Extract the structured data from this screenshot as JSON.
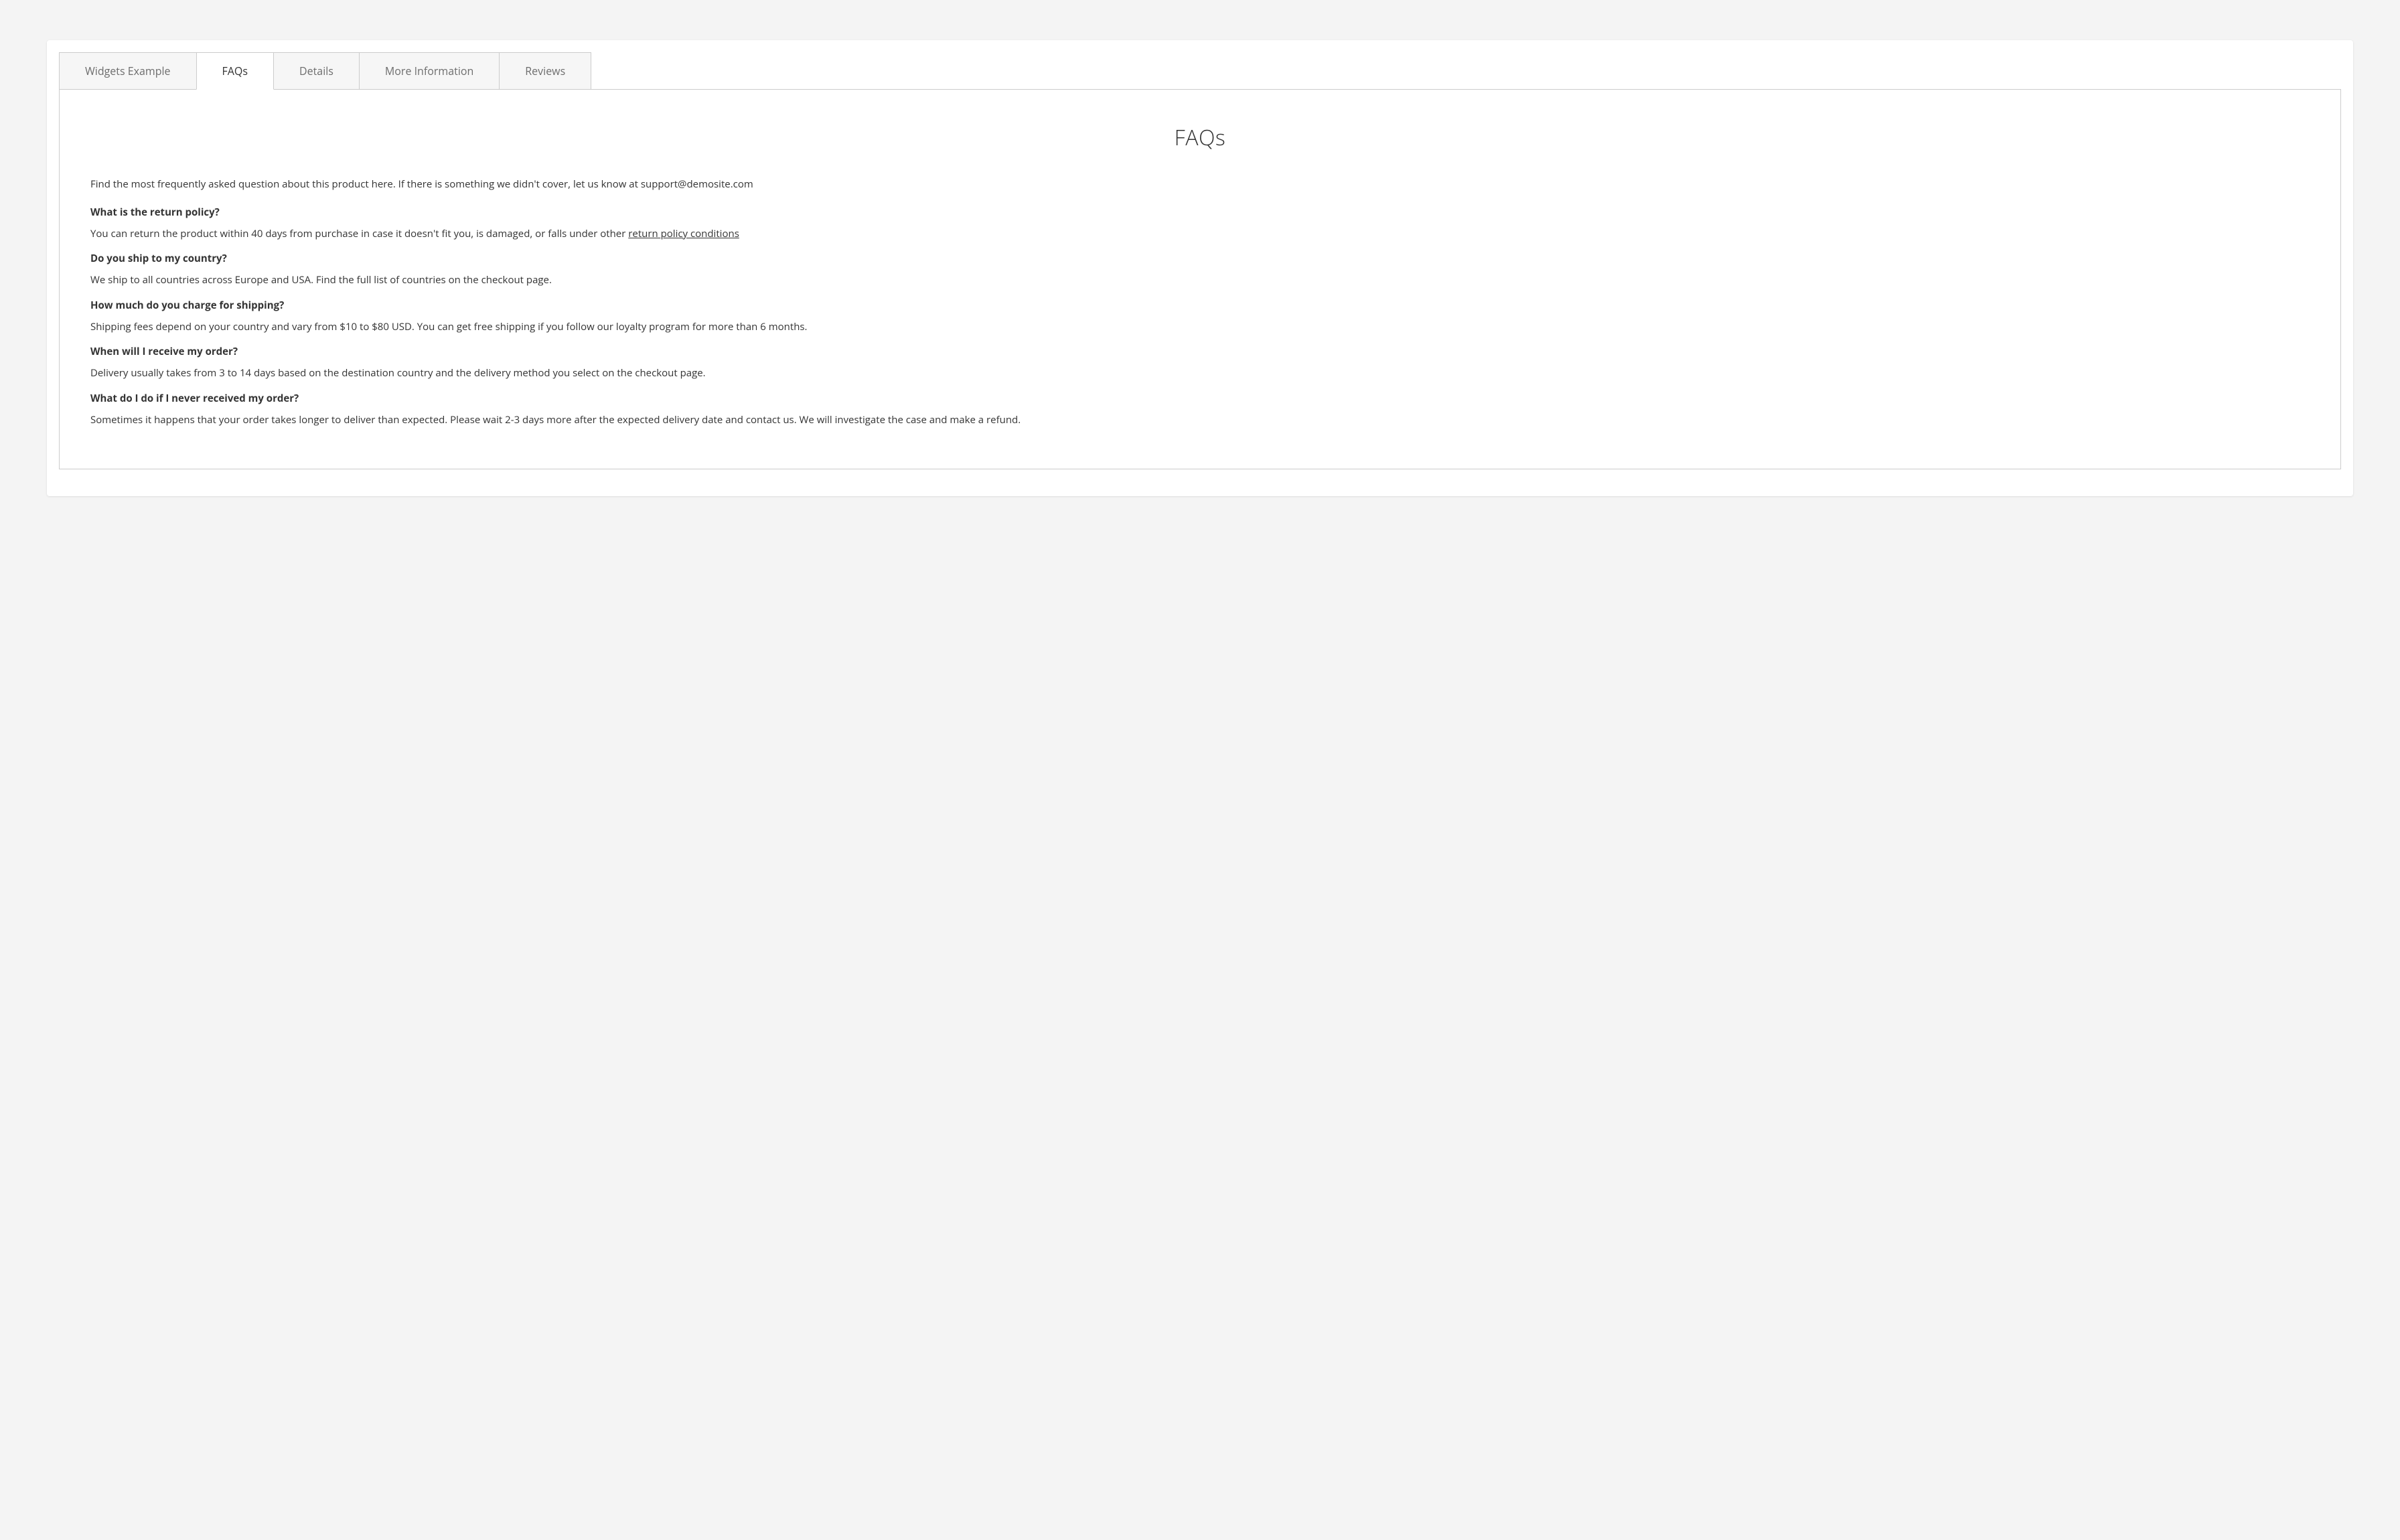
{
  "tabs": [
    {
      "label": "Widgets Example",
      "active": false
    },
    {
      "label": "FAQs",
      "active": true
    },
    {
      "label": "Details",
      "active": false
    },
    {
      "label": "More Information",
      "active": false
    },
    {
      "label": "Reviews",
      "active": false
    }
  ],
  "faq": {
    "title": "FAQs",
    "intro": "Find the most frequently asked question about this product here. If there is something we didn't cover, let us know at support@demosite.com",
    "items": [
      {
        "question": "What is the return policy?",
        "answer_before_link": "You can return the product within 40 days from purchase in case it doesn't fit you, is damaged, or falls under other ",
        "link_text": "return policy conditions",
        "answer_after_link": ""
      },
      {
        "question": "Do you ship to my country?",
        "answer": "We ship to all countries across Europe and USA. Find the full list of countries on the checkout page."
      },
      {
        "question": "How much do you charge for shipping?",
        "answer": "Shipping fees depend on your country and vary from $10 to $80 USD. You can get free shipping if you follow our loyalty program for more than 6 months."
      },
      {
        "question": "When will I receive my order?",
        "answer": "Delivery usually takes from 3 to 14 days based on the destination country and the delivery method you select on the checkout page."
      },
      {
        "question": "What do I do if I never received my order?",
        "answer": "Sometimes it happens that your order takes longer to deliver than expected. Please wait 2-3 days more after the expected delivery date and contact us. We will investigate the case and make a refund."
      }
    ]
  }
}
